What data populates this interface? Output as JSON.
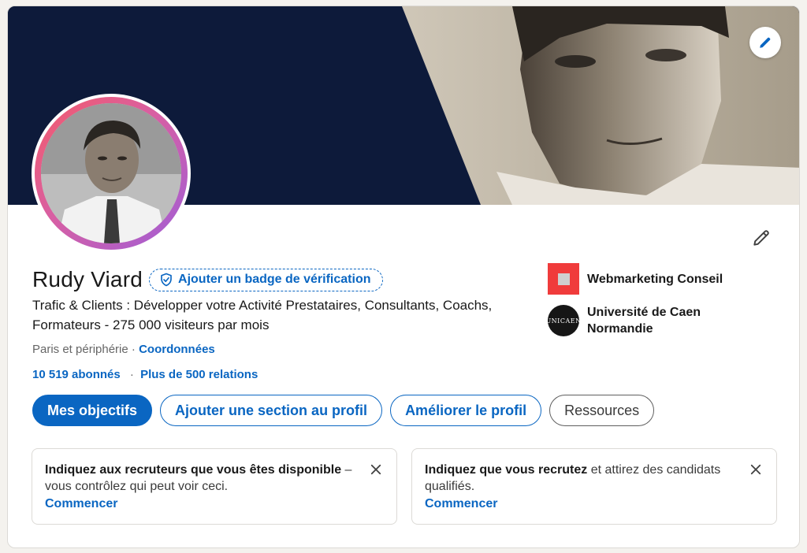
{
  "profile": {
    "name": "Rudy Viard",
    "verification_badge": "Ajouter un badge de vérification",
    "headline": "Trafic & Clients : Développer votre Activité Prestataires, Consultants, Coachs, Formateurs - 275 000 visiteurs par mois",
    "location": "Paris et périphérie",
    "location_separator": "·",
    "contact_link": "Coordonnées",
    "followers": "10 519 abonnés",
    "network_separator": "·",
    "connections": "Plus de 500 relations"
  },
  "actions": {
    "primary": "Mes objectifs",
    "add_section": "Ajouter une section au profil",
    "enhance": "Améliorer le profil",
    "resources": "Ressources"
  },
  "experience": {
    "company": "Webmarketing Conseil",
    "school": "Université de Caen Normandie",
    "school_logo_text": "UNICAEN"
  },
  "promos": [
    {
      "bold": "Indiquez aux recruteurs que vous êtes disponible",
      "rest": " – vous contrôlez qui peut voir ceci.",
      "cta": "Commencer"
    },
    {
      "bold": "Indiquez que vous recrutez",
      "rest": " et attirez des candidats qualifiés.",
      "cta": "Commencer"
    }
  ],
  "icons": {
    "cover_edit": "pencil-icon",
    "intro_edit": "pencil-icon",
    "verification": "shield-check-icon",
    "close": "close-icon"
  },
  "colors": {
    "accent": "#0a66c2",
    "cover_dark": "#0d1a3a",
    "avatar_gradient_start": "#f45b69",
    "avatar_gradient_end": "#9f5ed8",
    "company_logo": "#f03b3b"
  }
}
